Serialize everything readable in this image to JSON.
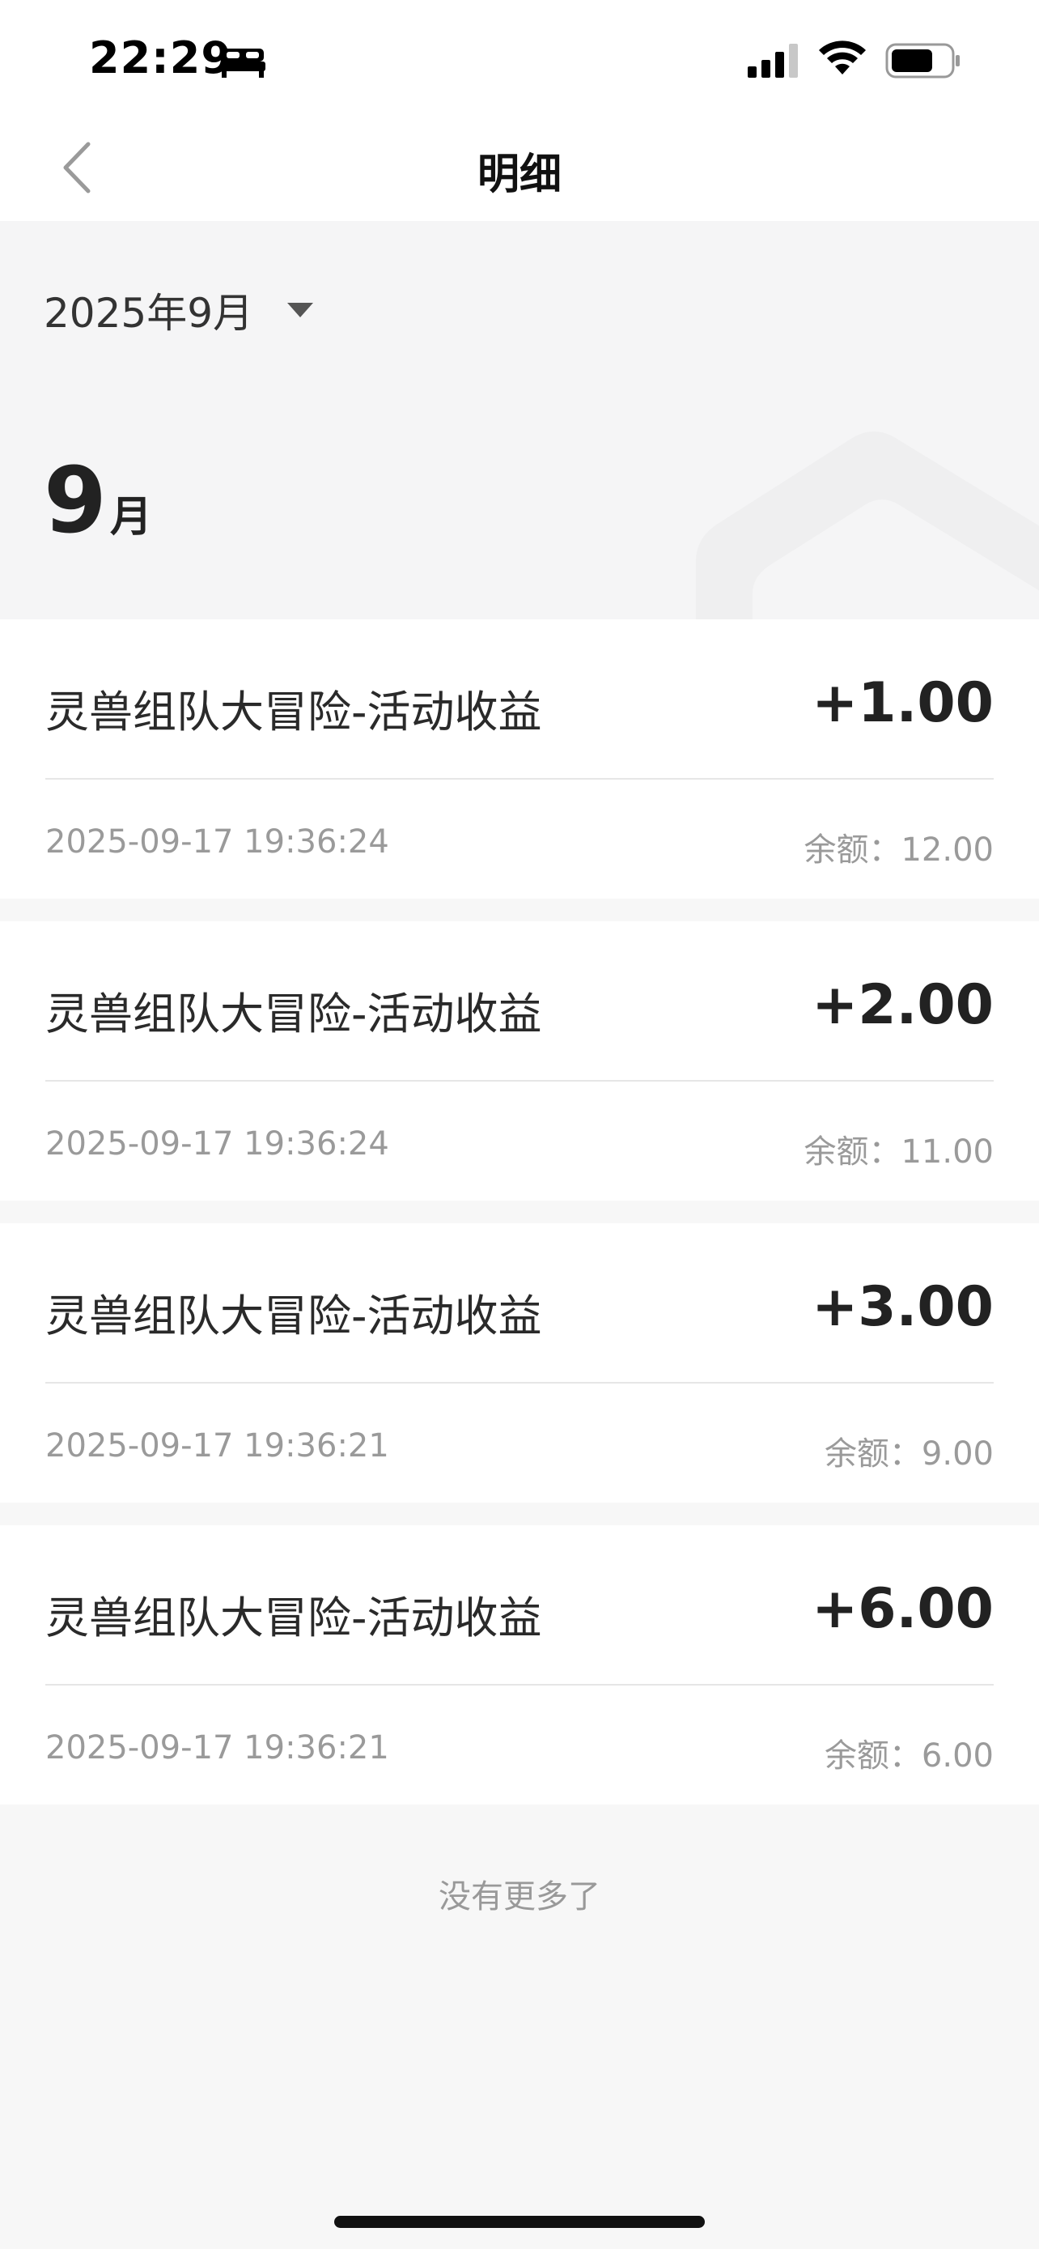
{
  "status_bar": {
    "time": "22:29"
  },
  "nav": {
    "title": "明细"
  },
  "filter": {
    "month_label": "2025年9月"
  },
  "section": {
    "month_number": "9",
    "month_suffix": "月"
  },
  "transactions": [
    {
      "title": "灵兽组队大冒险-活动收益",
      "amount": "+1.00",
      "time": "2025-09-17 19:36:24",
      "balance": "余额：12.00"
    },
    {
      "title": "灵兽组队大冒险-活动收益",
      "amount": "+2.00",
      "time": "2025-09-17 19:36:24",
      "balance": "余额：11.00"
    },
    {
      "title": "灵兽组队大冒险-活动收益",
      "amount": "+3.00",
      "time": "2025-09-17 19:36:21",
      "balance": "余额：9.00"
    },
    {
      "title": "灵兽组队大冒险-活动收益",
      "amount": "+6.00",
      "time": "2025-09-17 19:36:21",
      "balance": "余额：6.00"
    }
  ],
  "footer": {
    "no_more_text": "没有更多了"
  },
  "icons": {
    "status": [
      "bed-icon",
      "signal-icon",
      "wifi-icon",
      "battery-icon"
    ],
    "nav": [
      "back-chevron-icon"
    ],
    "filter": [
      "caret-down-icon"
    ]
  },
  "colors": {
    "page_background": "#f7f7f7",
    "card_background": "#ffffff",
    "primary_text": "#333333",
    "secondary_text": "#9a9a9a"
  }
}
